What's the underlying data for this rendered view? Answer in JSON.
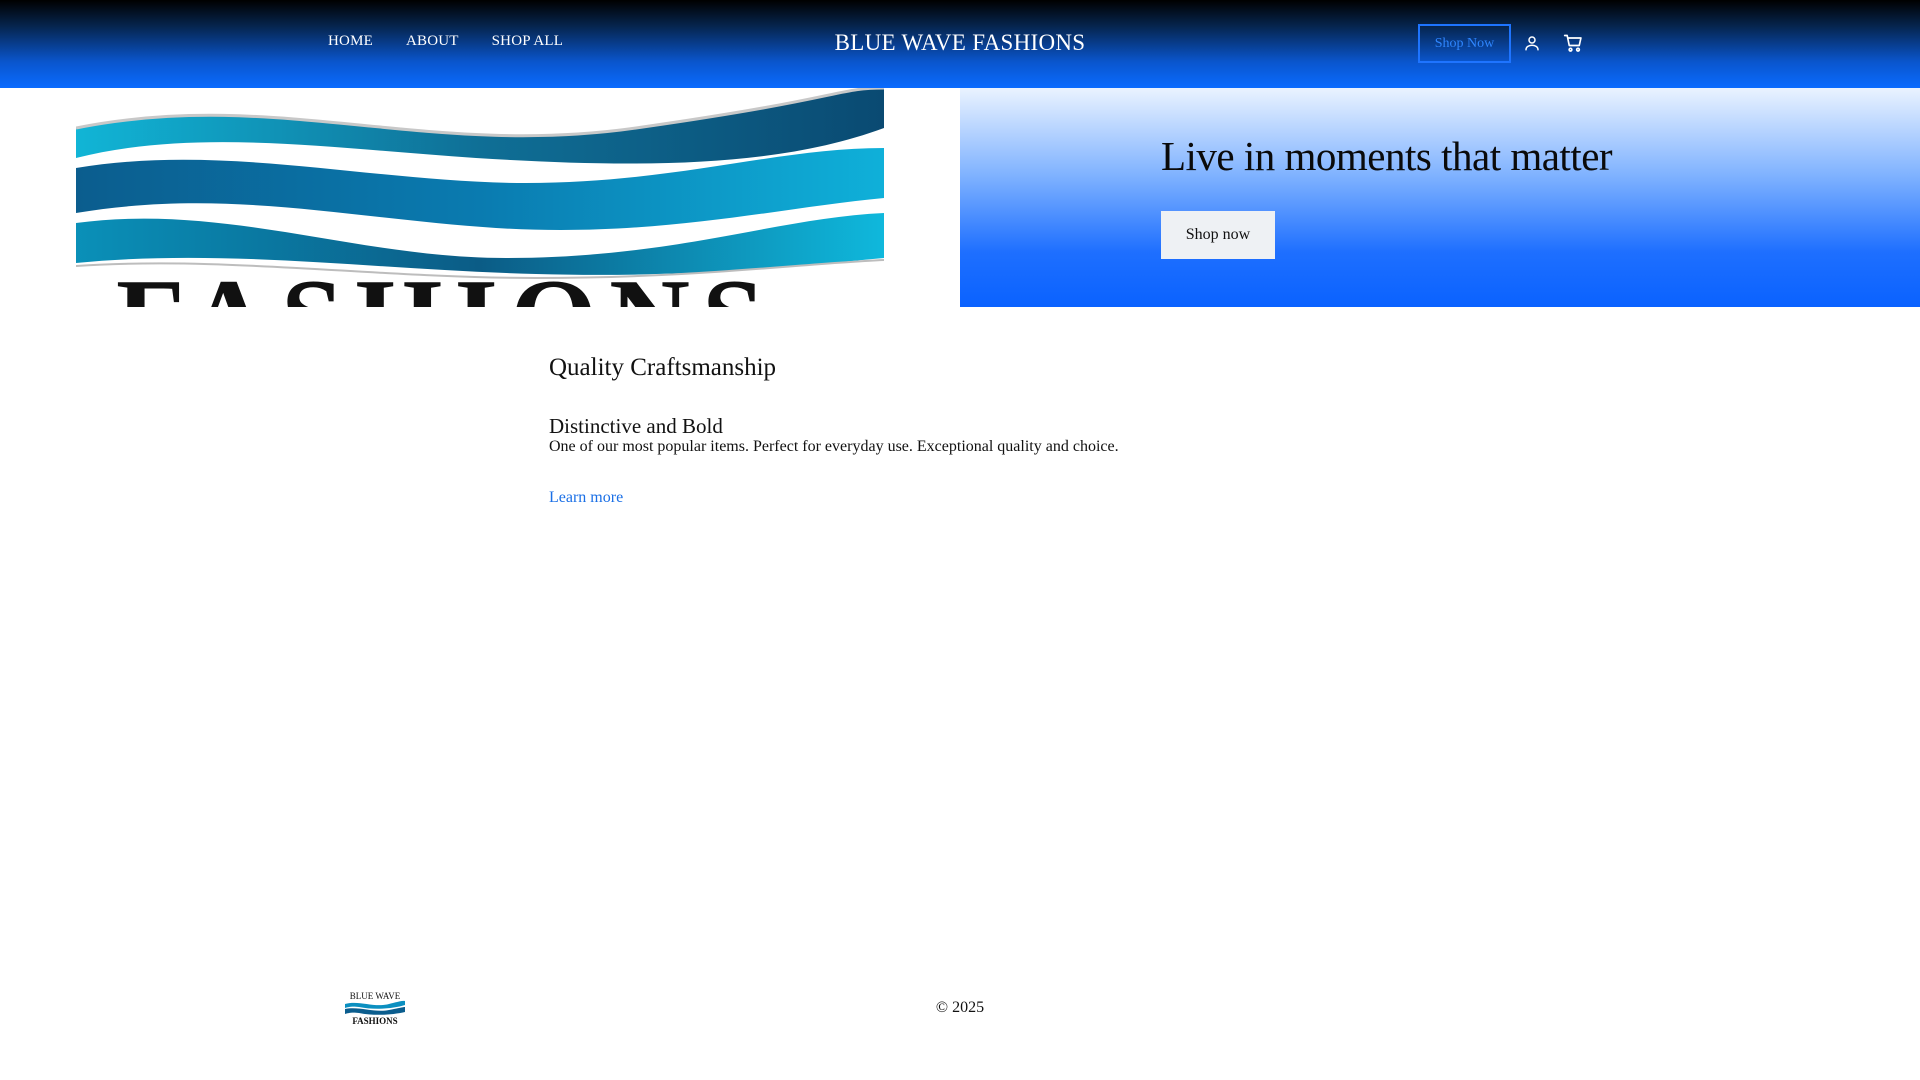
{
  "header": {
    "nav": [
      {
        "label": "HOME"
      },
      {
        "label": "ABOUT"
      },
      {
        "label": "SHOP ALL"
      }
    ],
    "brand_title": "BLUE WAVE FASHIONS",
    "shop_button_label": "Shop Now",
    "icons": {
      "account": "user-icon",
      "cart": "cart-icon"
    }
  },
  "hero": {
    "image_logo_text": "FASHIONS",
    "heading": "Live in moments that matter",
    "button_label": "Shop now"
  },
  "content": {
    "section_title": "Quality Craftsmanship",
    "feature_title": "Distinctive and Bold",
    "feature_description": "One of our most popular items. Perfect for everyday use. Exceptional quality and choice.",
    "link_label": "Learn more"
  },
  "footer": {
    "logo_line1": "BLUE WAVE",
    "logo_line2": "FASHIONS",
    "copyright": "© 2025"
  },
  "colors": {
    "accent": "#0a6bff",
    "link": "#1a6fe6",
    "header_top": "#000000"
  }
}
